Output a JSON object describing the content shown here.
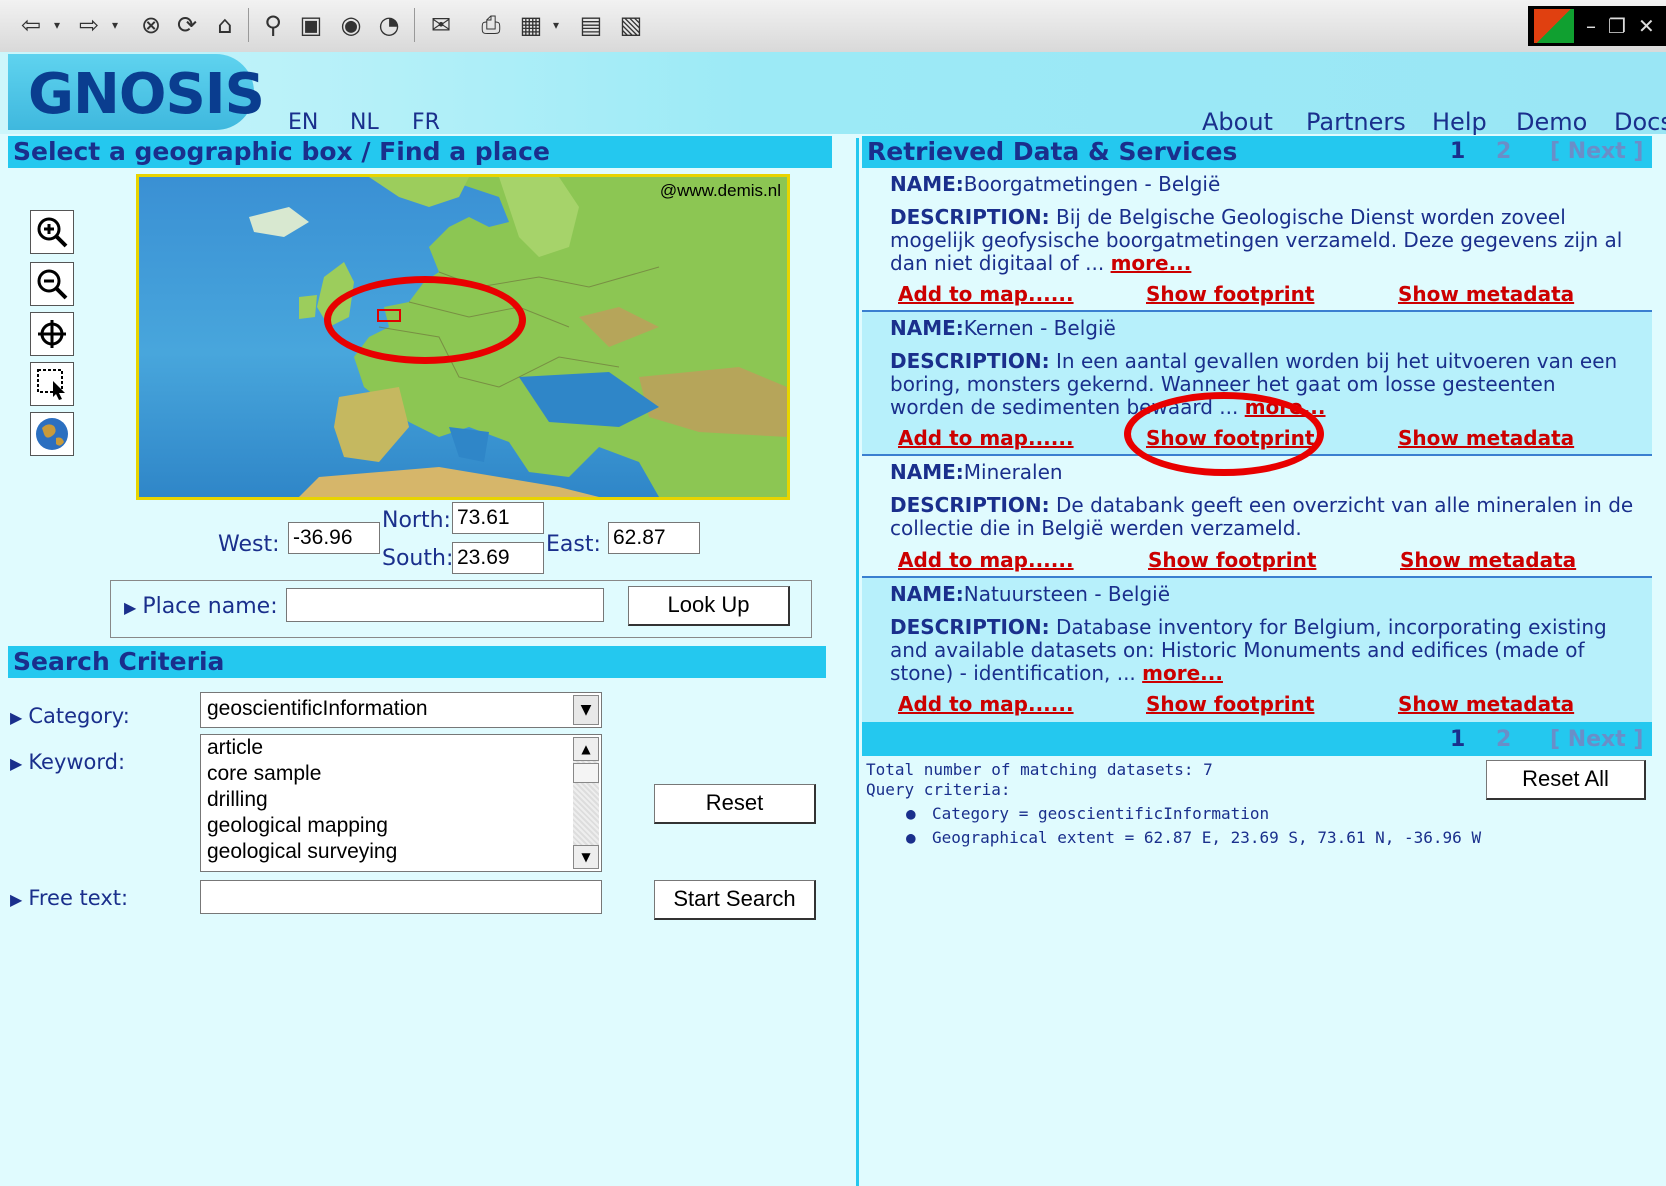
{
  "window": {
    "toolbar_icons": [
      "back-icon",
      "forward-icon",
      "stop-icon",
      "refresh-icon",
      "home-icon",
      "search-icon",
      "favorites-icon",
      "media-icon",
      "history-icon",
      "mail-icon",
      "print-icon",
      "edit-icon",
      "discuss-icon",
      "research-icon"
    ],
    "controls": {
      "minimize": "–",
      "restore": "❐",
      "close": "✕"
    }
  },
  "header": {
    "logo": "GNOSIS",
    "languages": [
      "EN",
      "NL",
      "FR"
    ],
    "nav": [
      "About",
      "Partners",
      "Help",
      "Demo",
      "Docs"
    ]
  },
  "geo": {
    "section_title": "Select a geographic box / Find a place",
    "map_credit": "@www.demis.nl",
    "tools": [
      "zoom-in-icon",
      "zoom-out-icon",
      "pan-icon",
      "select-box-icon",
      "globe-icon"
    ],
    "west_label": "West:",
    "west_value": "-36.96",
    "north_label": "North:",
    "north_value": "73.61",
    "east_label": "East:",
    "east_value": "62.87",
    "south_label": "South:",
    "south_value": "23.69",
    "place_label": "Place name:",
    "place_value": "",
    "lookup_label": "Look Up"
  },
  "search": {
    "section_title": "Search Criteria",
    "category_label": "Category:",
    "category_value": "geoscientificInformation",
    "keyword_label": "Keyword:",
    "keywords": [
      "article",
      "core sample",
      "drilling",
      "geological mapping",
      "geological surveying"
    ],
    "freetext_label": "Free text:",
    "freetext_value": "",
    "reset_label": "Reset",
    "start_label": "Start Search"
  },
  "results": {
    "section_title": "Retrieved Data & Services",
    "pages": [
      "1",
      "2"
    ],
    "next_label": "[ Next ]",
    "name_prefix": "NAME:",
    "desc_prefix": "DESCRIPTION:",
    "more_label": "more...",
    "add_label": "Add to map......",
    "footprint_label": "Show footprint",
    "metadata_label": "Show metadata",
    "items": [
      {
        "name": "Boorgatmetingen - België",
        "desc": [
          " Bij de Belgische Geologische Dienst worden zoveel",
          "mogelijk geofysische boorgatmetingen verzameld. Deze gegevens zijn al",
          "dan niet digitaal of ... "
        ]
      },
      {
        "name": "Kernen - België",
        "desc": [
          " In een aantal gevallen worden bij het uitvoeren van een",
          "boring, monsters gekernd. Wanneer het gaat om losse gesteenten",
          "worden de sedimenten bewaard ... "
        ]
      },
      {
        "name": "Mineralen",
        "desc": [
          " De databank geeft een overzicht van alle mineralen in de",
          "collectie die in België werden verzameld."
        ]
      },
      {
        "name": "Natuursteen - België",
        "desc": [
          " Database inventory for Belgium, incorporating existing",
          "and available datasets on: Historic Monuments and edifices (made of",
          "stone) - identification, ... "
        ]
      }
    ],
    "total_text": "Total number of matching datasets: 7",
    "criteria_label": "Query criteria:",
    "criteria": [
      "Category = geoscientificInformation",
      "Geographical extent = 62.87 E, 23.69 S, 73.61 N, -36.96 W"
    ],
    "reset_all_label": "Reset All"
  },
  "colors": {
    "accent": "#24c8ef",
    "link": "#cc0000",
    "text": "#1a2f8c",
    "background": "#e0fbfe",
    "highlight": "#e80000"
  }
}
